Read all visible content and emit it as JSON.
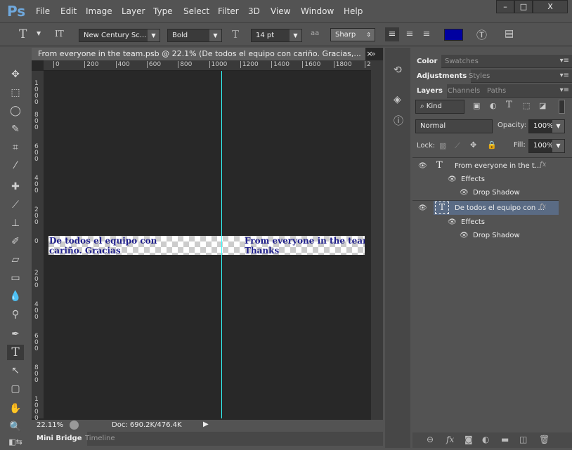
{
  "app": {
    "logo": "Ps",
    "menu": [
      "File",
      "Edit",
      "Image",
      "Layer",
      "Type",
      "Select",
      "Filter",
      "3D",
      "View",
      "Window",
      "Help"
    ],
    "window_buttons": [
      "–",
      "□",
      "X"
    ]
  },
  "options": {
    "tool_icon": "T",
    "orient_icon": "IT",
    "font_family": "New Century Sc...",
    "font_style": "Bold",
    "size_icon": "T",
    "font_size": "14 pt",
    "aa_icon": "aa",
    "antialias": "Sharp",
    "text_color": "#0000a0"
  },
  "document": {
    "tab_title": "From everyone in the team.psb @ 22.1% (De todos el equipo con cariño. Gracias,...",
    "close": "×",
    "collapse": "»",
    "hruler": [
      "0",
      "200",
      "400",
      "600",
      "800",
      "1000",
      "1200",
      "1400",
      "1600",
      "1800",
      "20("
    ],
    "vruler": [
      "1000",
      "800",
      "600",
      "400",
      "200",
      "0",
      "200",
      "400",
      "600",
      "800",
      "1000"
    ],
    "text_left": [
      "De todos el equipo con",
      "cariño. Gracias"
    ],
    "text_right": [
      "From everyone in the team",
      "Thanks"
    ],
    "text_color": "#1f1f8c",
    "guide_color": "#33ffff"
  },
  "status": {
    "zoom": "22.11%",
    "doc": "Doc: 690.2K/476.4K"
  },
  "bottom_tabs": [
    "Mini Bridge",
    "Timeline"
  ],
  "panels": {
    "group1": [
      "Color",
      "Swatches"
    ],
    "group2": [
      "Adjustments",
      "Styles"
    ],
    "group3": [
      "Layers",
      "Channels",
      "Paths"
    ],
    "filter": "Kind",
    "blend": "Normal",
    "opacity_label": "Opacity:",
    "opacity": "100%",
    "lock_label": "Lock:",
    "fill_label": "Fill:",
    "fill": "100%",
    "layers": [
      {
        "name": "From everyone in the t...",
        "fx": "fx",
        "effects": "Effects",
        "shadow": "Drop Shadow",
        "selected": false
      },
      {
        "name": "De todos el equipo con ...",
        "fx": "fx",
        "effects": "Effects",
        "shadow": "Drop Shadow",
        "selected": true
      }
    ],
    "footer_icons": [
      "link",
      "fx",
      "mask",
      "adjustment",
      "folder",
      "new-layer",
      "trash"
    ]
  }
}
